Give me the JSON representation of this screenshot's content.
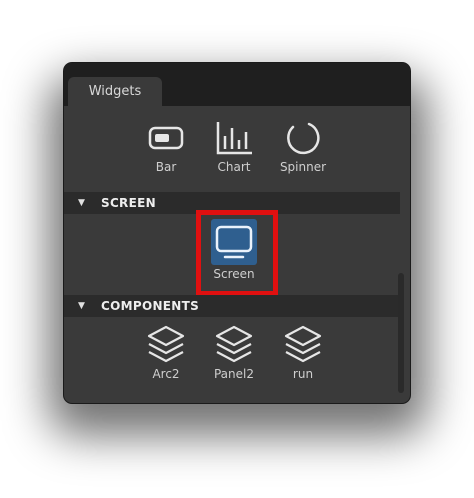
{
  "panel": {
    "tab_label": "Widgets"
  },
  "widgets_row": [
    {
      "label": "Bar",
      "icon": "bar-icon"
    },
    {
      "label": "Chart",
      "icon": "chart-icon"
    },
    {
      "label": "Spinner",
      "icon": "spinner-icon"
    }
  ],
  "sections": {
    "screen": {
      "title": "SCREEN",
      "items": [
        {
          "label": "Screen",
          "icon": "monitor-icon",
          "selected": true
        }
      ]
    },
    "components": {
      "title": "COMPONENTS",
      "items": [
        {
          "label": "Arc2",
          "icon": "layers-icon"
        },
        {
          "label": "Panel2",
          "icon": "layers-icon"
        },
        {
          "label": "run",
          "icon": "layers-icon"
        }
      ]
    }
  },
  "colors": {
    "panel_bg": "#3a3a3a",
    "tabbar_bg": "#1f1f1f",
    "header_bg": "#2b2b2b",
    "selection_blue": "#2f5f8f",
    "highlight_red": "#e01010"
  }
}
